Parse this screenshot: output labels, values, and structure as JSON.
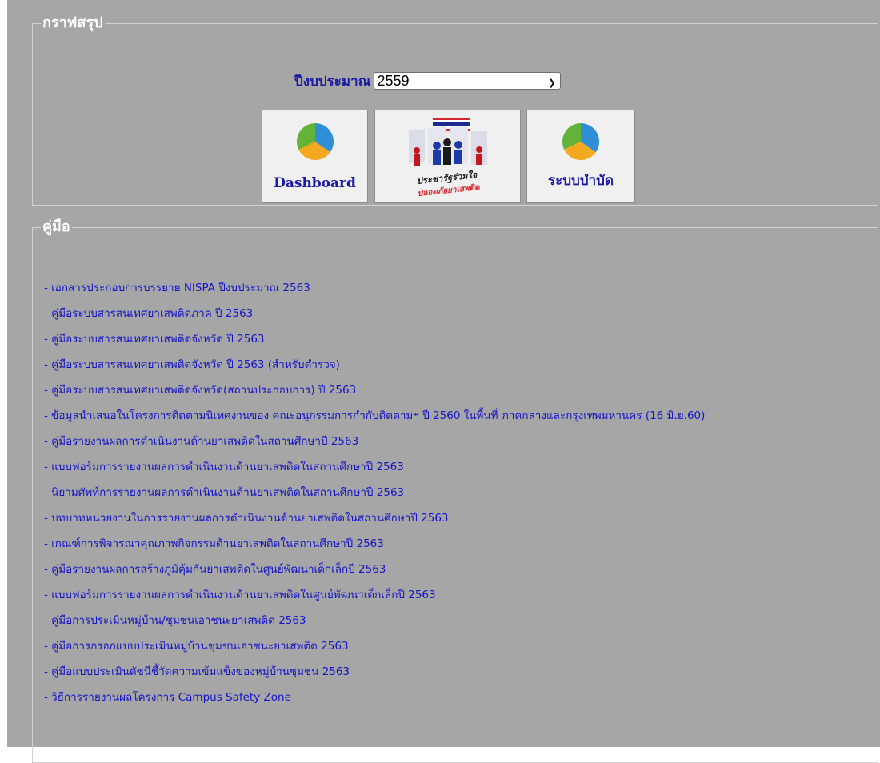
{
  "graph_section": {
    "legend": "กราฟสรุป",
    "year_label": "ปีงบประมาณ",
    "year_value": "2559",
    "buttons": [
      {
        "label": "Dashboard",
        "icon": "pie-chart-icon"
      },
      {
        "label": "ประชารัฐร่วมใจ ปลอดภัยยาเสพติด",
        "icon": "campaign-logo"
      },
      {
        "label": "ระบบบำบัด",
        "icon": "pie-chart-icon"
      }
    ]
  },
  "manual_section": {
    "legend": "คู่มือ",
    "links": [
      "- เอกสารประกอบการบรรยาย NISPA ปีงบประมาณ 2563",
      "- คู่มือระบบสารสนเทศยาเสพติดภาค ปี 2563",
      "- คู่มือระบบสารสนเทศยาเสพติดจังหวัด ปี 2563",
      "- คู่มือระบบสารสนเทศยาเสพติดจังหวัด ปี 2563 (สำหรับตำรวจ)",
      "- คู่มือระบบสารสนเทศยาเสพติดจังหวัด(สถานประกอบการ) ปี 2563",
      "- ข้อมูลนำเสนอในโครงการติดตามนิเทศงานของ คณะอนุกรรมการกำกับติดตามฯ ปี 2560 ในพื้นที่ ภาคกลางและกรุงเทพมหานคร (16 มิ.ย.60)",
      "- คู่มือรายงานผลการดำเนินงานด้านยาเสพติดในสถานศึกษาปี 2563",
      "- แบบฟอร์มการรายงานผลการดำเนินงานด้านยาเสพติดในสถานศึกษาปี 2563",
      "- นิยามศัพท์การรายงานผลการดำเนินงานด้านยาเสพติดในสถานศึกษาปี 2563",
      "- บทบาทหน่วยงานในการรายงานผลการดำเนินงานด้านยาเสพติดในสถานศึกษาปี 2563",
      "- เกณฑ์การพิจารณาคุณภาพกิจกรรมด้านยาเสพติดในสถานศึกษาปี 2563",
      "- คู่มือรายงานผลการสร้างภูมิคุ้มกันยาเสพติดในศูนย์พัฒนาเด็กเล็กปี 2563",
      "- แบบฟอร์มการรายงานผลการดำเนินงานด้านยาเสพติดในศูนย์พัฒนาเด็กเล็กปี 2563",
      "- คู่มือการประเมินหมู่บ้าน/ชุมชนเอาชนะยาเสพติด 2563",
      "- คู่มือการกรอกแบบประเมินหมู่บ้านชุมชนเอาชนะยาเสพติด 2563",
      "- คู่มือแบบประเมินดัชนีชี้วัดความเข้มแข็งของหมู่บ้านชุมชน 2563",
      "- วิธีการรายงานผลโครงการ Campus Safety Zone"
    ]
  }
}
